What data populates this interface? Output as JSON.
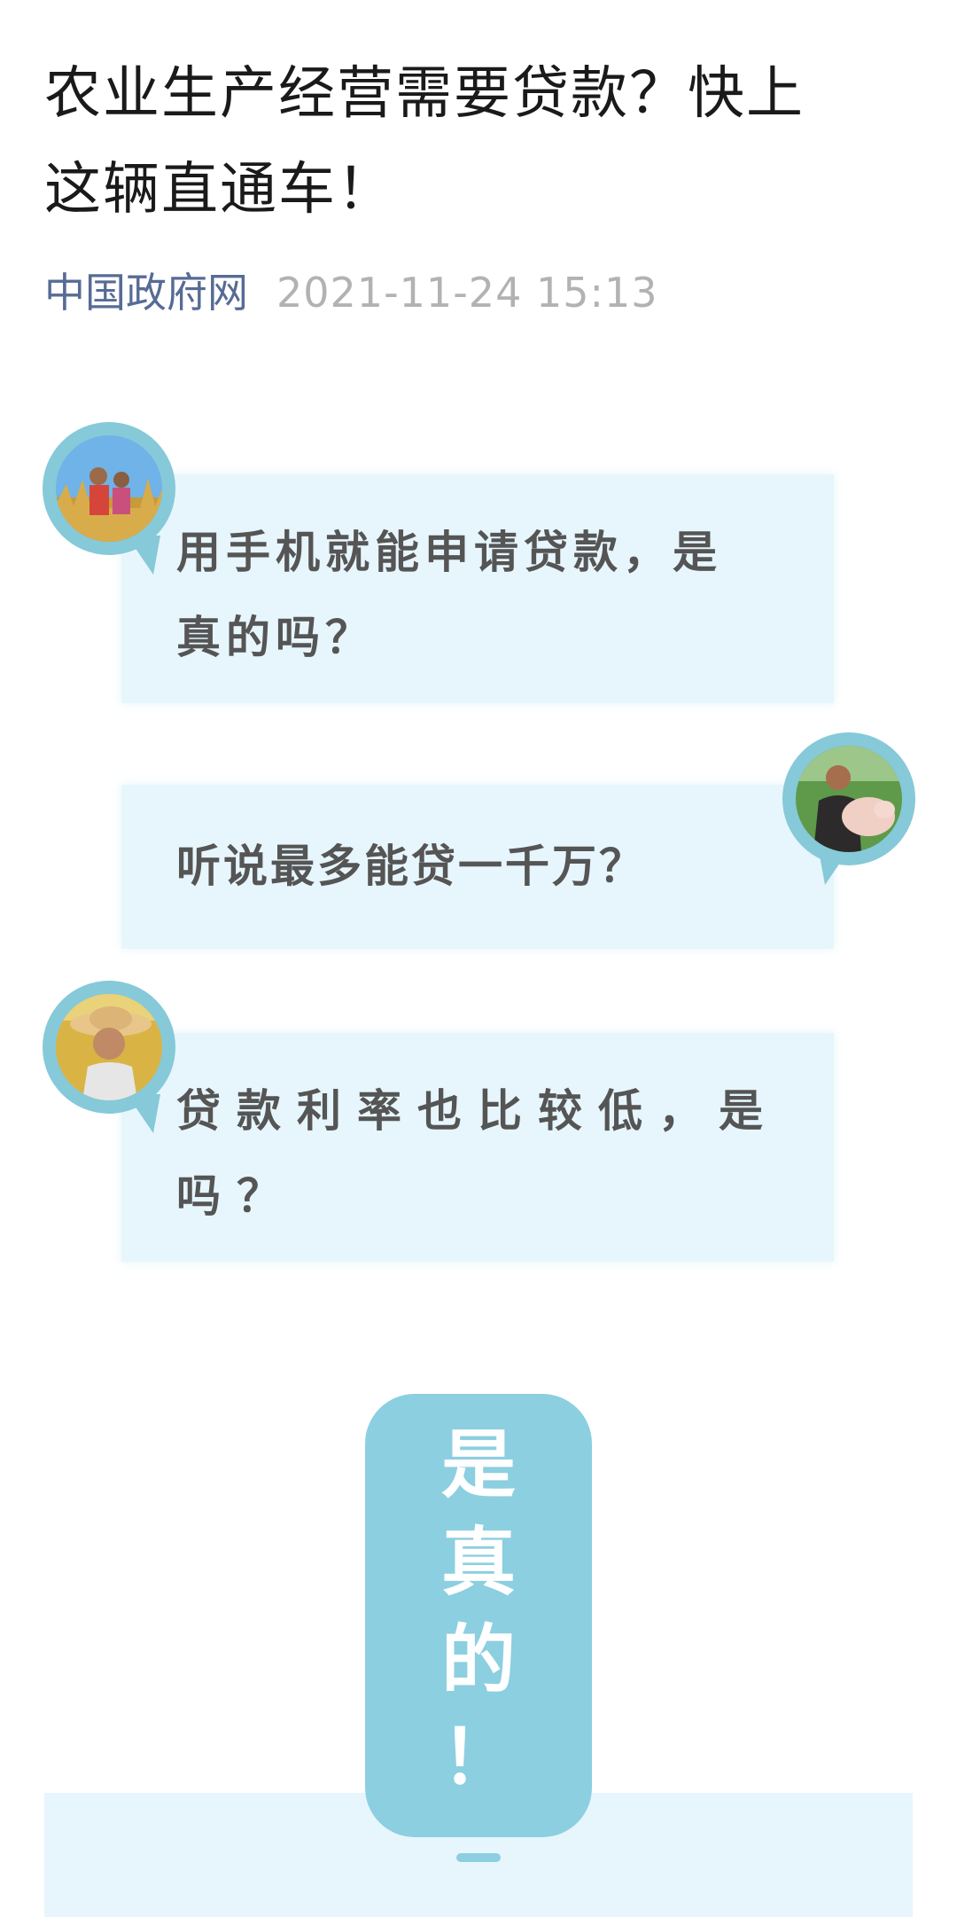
{
  "article": {
    "title_line1": "农业生产经营需要贷款？快上",
    "title_line2": "这辆直通车！",
    "source": "中国政府网",
    "date": "2021-11-24 15:13"
  },
  "chat": [
    {
      "line1": "用手机就能申请贷款，是",
      "line2": "真的吗？",
      "avatar": "farmer-couple-avatar"
    },
    {
      "line1": "听说最多能贷一千万？",
      "avatar": "farmer-with-pig-avatar"
    },
    {
      "line1": "贷款利率也比较低，是",
      "line2": "吗？",
      "avatar": "woman-in-straw-hat-avatar"
    }
  ],
  "answer": {
    "chars": [
      "是",
      "真",
      "的",
      "！"
    ]
  },
  "colors": {
    "accent": "#8ccfe0",
    "bubble": "#e7f6fc",
    "source_link": "#576b95",
    "date": "#b2b2b2"
  }
}
